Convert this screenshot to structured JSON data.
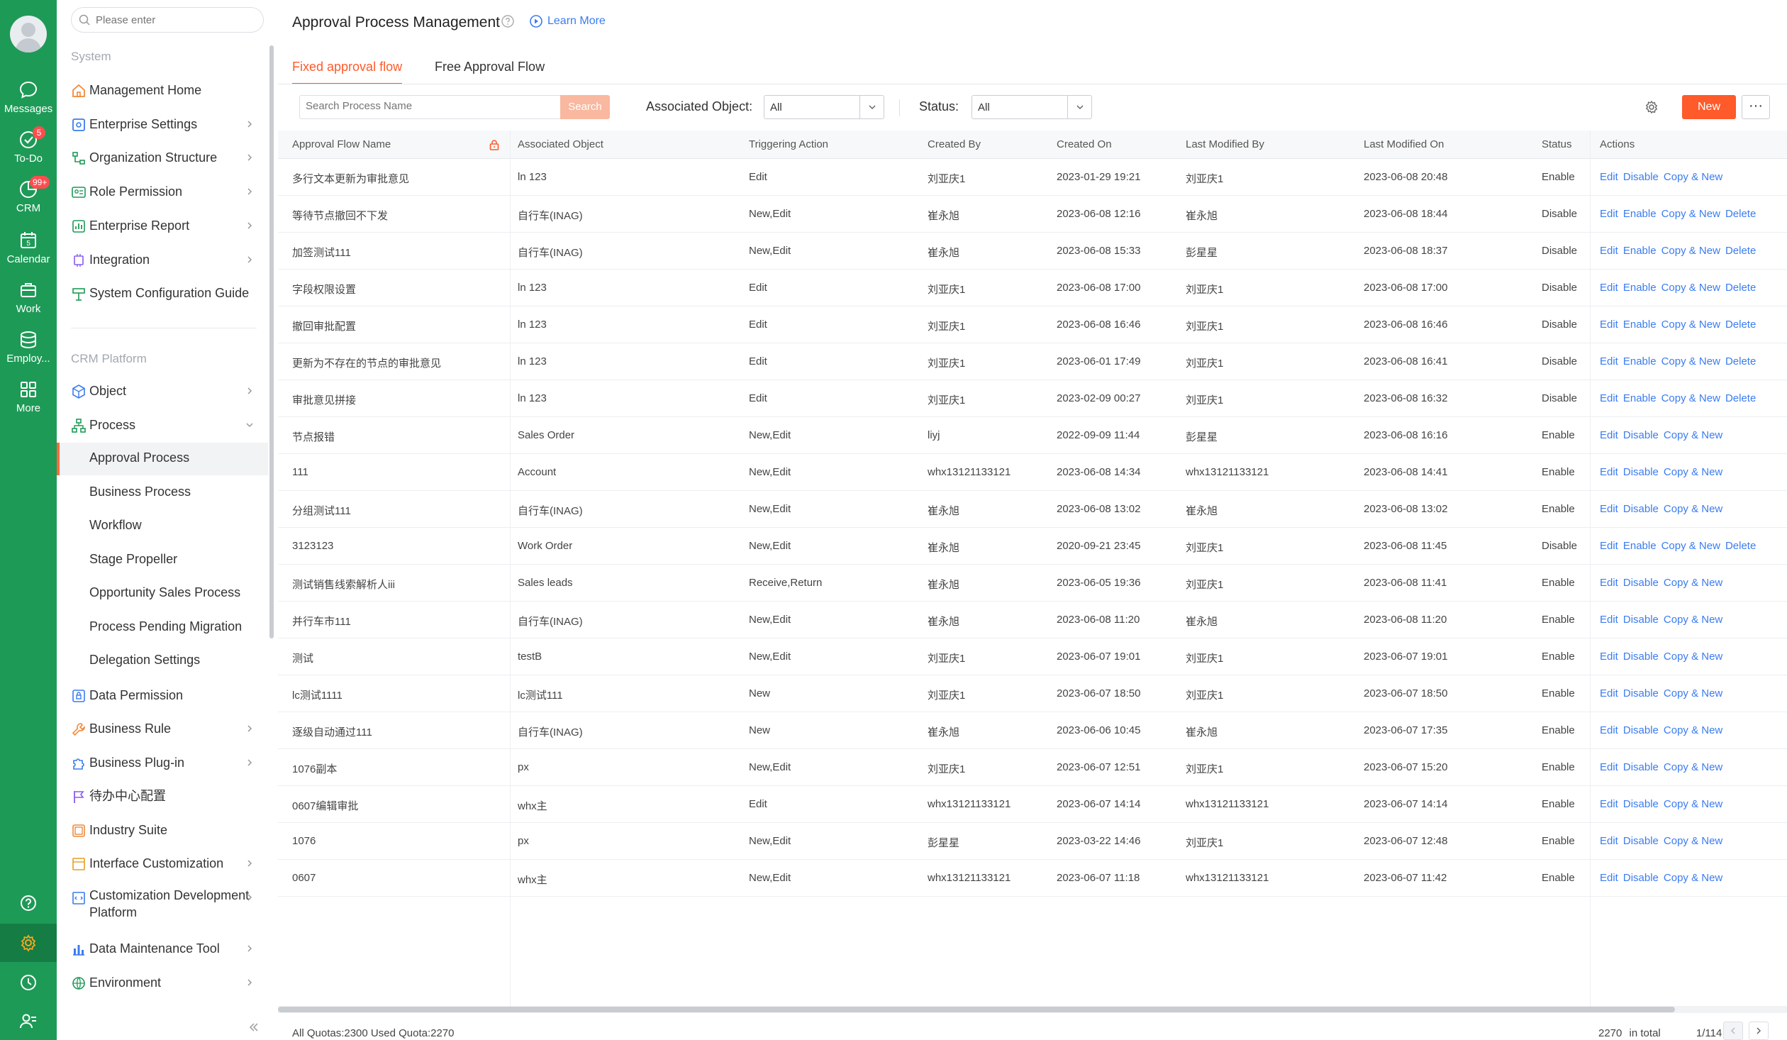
{
  "rail": {
    "items": [
      {
        "label": "Messages",
        "icon": "chat-bubble-icon"
      },
      {
        "label": "To-Do",
        "icon": "check-circle-icon",
        "badge": "5"
      },
      {
        "label": "CRM",
        "icon": "crm-chart-icon",
        "badge": "99+"
      },
      {
        "label": "Calendar",
        "icon": "calendar-icon",
        "day": "5"
      },
      {
        "label": "Work",
        "icon": "briefcase-icon"
      },
      {
        "label": "Employ...",
        "icon": "database-icon"
      },
      {
        "label": "More",
        "icon": "grid-icon"
      }
    ]
  },
  "nav": {
    "search_placeholder": "Please enter",
    "section_system": "System",
    "section_crm": "CRM Platform",
    "system_items": [
      {
        "label": "Management Home"
      },
      {
        "label": "Enterprise Settings"
      },
      {
        "label": "Organization Structure"
      },
      {
        "label": "Role Permission"
      },
      {
        "label": "Enterprise Report"
      },
      {
        "label": "Integration"
      },
      {
        "label": "System Configuration Guide"
      }
    ],
    "crm_items": [
      {
        "label": "Object"
      },
      {
        "label": "Process"
      }
    ],
    "process_children": [
      {
        "label": "Approval Process"
      },
      {
        "label": "Business Process"
      },
      {
        "label": "Workflow"
      },
      {
        "label": "Stage Propeller"
      },
      {
        "label": "Opportunity Sales Process"
      },
      {
        "label": "Process Pending Migration"
      },
      {
        "label": "Delegation Settings"
      }
    ],
    "crm_items_after": [
      {
        "label": "Data Permission"
      },
      {
        "label": "Business Rule"
      },
      {
        "label": "Business Plug-in"
      },
      {
        "label": "待办中心配置"
      },
      {
        "label": "Industry Suite"
      },
      {
        "label": "Interface Customization"
      },
      {
        "label": "Customization Development Platform"
      },
      {
        "label": "Data Maintenance Tool"
      },
      {
        "label": "Environment"
      }
    ]
  },
  "header": {
    "title": "Approval Process Management",
    "learn_more": "Learn More"
  },
  "tabs": [
    {
      "label": "Fixed approval flow"
    },
    {
      "label": "Free Approval Flow"
    }
  ],
  "toolbar": {
    "search_placeholder": "Search Process Name",
    "search_button": "Search",
    "assoc_label": "Associated Object:",
    "assoc_value": "All",
    "status_label": "Status:",
    "status_value": "All",
    "new_button": "New",
    "more_button": "···"
  },
  "table": {
    "columns": [
      "Approval Flow Name",
      "Associated Object",
      "Triggering Action",
      "Created By",
      "Created On",
      "Last Modified By",
      "Last Modified On",
      "Status",
      "Actions"
    ],
    "rows": [
      {
        "name": "多行文本更新为审批意见",
        "object": "ln 123",
        "action": "Edit",
        "created_by": "刘亚庆1",
        "created_on": "2023-01-29 19:21",
        "modified_by": "刘亚庆1",
        "modified_on": "2023-06-08 20:48",
        "status": "Enable",
        "actions": [
          "Edit",
          "Disable",
          "Copy & New"
        ]
      },
      {
        "name": "等待节点撤回不下发",
        "object": "自行车(INAG)",
        "action": "New,Edit",
        "created_by": "崔永旭",
        "created_on": "2023-06-08 12:16",
        "modified_by": "崔永旭",
        "modified_on": "2023-06-08 18:44",
        "status": "Disable",
        "actions": [
          "Edit",
          "Enable",
          "Copy & New",
          "Delete"
        ]
      },
      {
        "name": "加签测试111",
        "object": "自行车(INAG)",
        "action": "New,Edit",
        "created_by": "崔永旭",
        "created_on": "2023-06-08 15:33",
        "modified_by": "彭星星",
        "modified_on": "2023-06-08 18:37",
        "status": "Disable",
        "actions": [
          "Edit",
          "Enable",
          "Copy & New",
          "Delete"
        ]
      },
      {
        "name": "字段权限设置",
        "object": "ln 123",
        "action": "Edit",
        "created_by": "刘亚庆1",
        "created_on": "2023-06-08 17:00",
        "modified_by": "刘亚庆1",
        "modified_on": "2023-06-08 17:00",
        "status": "Disable",
        "actions": [
          "Edit",
          "Enable",
          "Copy & New",
          "Delete"
        ]
      },
      {
        "name": "撤回审批配置",
        "object": "ln 123",
        "action": "Edit",
        "created_by": "刘亚庆1",
        "created_on": "2023-06-08 16:46",
        "modified_by": "刘亚庆1",
        "modified_on": "2023-06-08 16:46",
        "status": "Disable",
        "actions": [
          "Edit",
          "Enable",
          "Copy & New",
          "Delete"
        ]
      },
      {
        "name": "更新为不存在的节点的审批意见",
        "object": "ln 123",
        "action": "Edit",
        "created_by": "刘亚庆1",
        "created_on": "2023-06-01 17:49",
        "modified_by": "刘亚庆1",
        "modified_on": "2023-06-08 16:41",
        "status": "Disable",
        "actions": [
          "Edit",
          "Enable",
          "Copy & New",
          "Delete"
        ]
      },
      {
        "name": "审批意见拼接",
        "object": "ln 123",
        "action": "Edit",
        "created_by": "刘亚庆1",
        "created_on": "2023-02-09 00:27",
        "modified_by": "刘亚庆1",
        "modified_on": "2023-06-08 16:32",
        "status": "Disable",
        "actions": [
          "Edit",
          "Enable",
          "Copy & New",
          "Delete"
        ]
      },
      {
        "name": "节点报错",
        "object": "Sales Order",
        "action": "New,Edit",
        "created_by": "liyj",
        "created_on": "2022-09-09 11:44",
        "modified_by": "彭星星",
        "modified_on": "2023-06-08 16:16",
        "status": "Enable",
        "actions": [
          "Edit",
          "Disable",
          "Copy & New"
        ]
      },
      {
        "name": "111",
        "object": "Account",
        "action": "New,Edit",
        "created_by": "whx13121133121",
        "created_on": "2023-06-08 14:34",
        "modified_by": "whx13121133121",
        "modified_on": "2023-06-08 14:41",
        "status": "Enable",
        "actions": [
          "Edit",
          "Disable",
          "Copy & New"
        ]
      },
      {
        "name": "分组测试111",
        "object": "自行车(INAG)",
        "action": "New,Edit",
        "created_by": "崔永旭",
        "created_on": "2023-06-08 13:02",
        "modified_by": "崔永旭",
        "modified_on": "2023-06-08 13:02",
        "status": "Enable",
        "actions": [
          "Edit",
          "Disable",
          "Copy & New"
        ]
      },
      {
        "name": "3123123",
        "object": "Work Order",
        "action": "New,Edit",
        "created_by": "崔永旭",
        "created_on": "2020-09-21 23:45",
        "modified_by": "刘亚庆1",
        "modified_on": "2023-06-08 11:45",
        "status": "Disable",
        "actions": [
          "Edit",
          "Enable",
          "Copy & New",
          "Delete"
        ]
      },
      {
        "name": "测试销售线索解析人iii",
        "object": "Sales leads",
        "action": "Receive,Return",
        "created_by": "崔永旭",
        "created_on": "2023-06-05 19:36",
        "modified_by": "刘亚庆1",
        "modified_on": "2023-06-08 11:41",
        "status": "Enable",
        "actions": [
          "Edit",
          "Disable",
          "Copy & New"
        ]
      },
      {
        "name": "并行车市111",
        "object": "自行车(INAG)",
        "action": "New,Edit",
        "created_by": "崔永旭",
        "created_on": "2023-06-08 11:20",
        "modified_by": "崔永旭",
        "modified_on": "2023-06-08 11:20",
        "status": "Enable",
        "actions": [
          "Edit",
          "Disable",
          "Copy & New"
        ]
      },
      {
        "name": "测试",
        "object": "testB",
        "action": "New,Edit",
        "created_by": "刘亚庆1",
        "created_on": "2023-06-07 19:01",
        "modified_by": "刘亚庆1",
        "modified_on": "2023-06-07 19:01",
        "status": "Enable",
        "actions": [
          "Edit",
          "Disable",
          "Copy & New"
        ]
      },
      {
        "name": "lc测试1111",
        "object": "lc测试111",
        "action": "New",
        "created_by": "刘亚庆1",
        "created_on": "2023-06-07 18:50",
        "modified_by": "刘亚庆1",
        "modified_on": "2023-06-07 18:50",
        "status": "Enable",
        "actions": [
          "Edit",
          "Disable",
          "Copy & New"
        ]
      },
      {
        "name": "逐级自动通过111",
        "object": "自行车(INAG)",
        "action": "New",
        "created_by": "崔永旭",
        "created_on": "2023-06-06 10:45",
        "modified_by": "崔永旭",
        "modified_on": "2023-06-07 17:35",
        "status": "Enable",
        "actions": [
          "Edit",
          "Disable",
          "Copy & New"
        ]
      },
      {
        "name": "1076副本",
        "object": "px",
        "action": "New,Edit",
        "created_by": "刘亚庆1",
        "created_on": "2023-06-07 12:51",
        "modified_by": "刘亚庆1",
        "modified_on": "2023-06-07 15:20",
        "status": "Enable",
        "actions": [
          "Edit",
          "Disable",
          "Copy & New"
        ]
      },
      {
        "name": "0607编辑审批",
        "object": "whx主",
        "action": "Edit",
        "created_by": "whx13121133121",
        "created_on": "2023-06-07 14:14",
        "modified_by": "whx13121133121",
        "modified_on": "2023-06-07 14:14",
        "status": "Enable",
        "actions": [
          "Edit",
          "Disable",
          "Copy & New"
        ]
      },
      {
        "name": "1076",
        "object": "px",
        "action": "New,Edit",
        "created_by": "彭星星",
        "created_on": "2023-03-22 14:46",
        "modified_by": "刘亚庆1",
        "modified_on": "2023-06-07 12:48",
        "status": "Enable",
        "actions": [
          "Edit",
          "Disable",
          "Copy & New"
        ]
      },
      {
        "name": "0607",
        "object": "whx主",
        "action": "New,Edit",
        "created_by": "whx13121133121",
        "created_on": "2023-06-07 11:18",
        "modified_by": "whx13121133121",
        "modified_on": "2023-06-07 11:42",
        "status": "Enable",
        "actions": [
          "Edit",
          "Disable",
          "Copy & New"
        ]
      }
    ]
  },
  "footer": {
    "quota": "All Quotas:2300 Used Quota:2270",
    "total": "2270",
    "total_suffix": "in total",
    "page": "1/114"
  }
}
